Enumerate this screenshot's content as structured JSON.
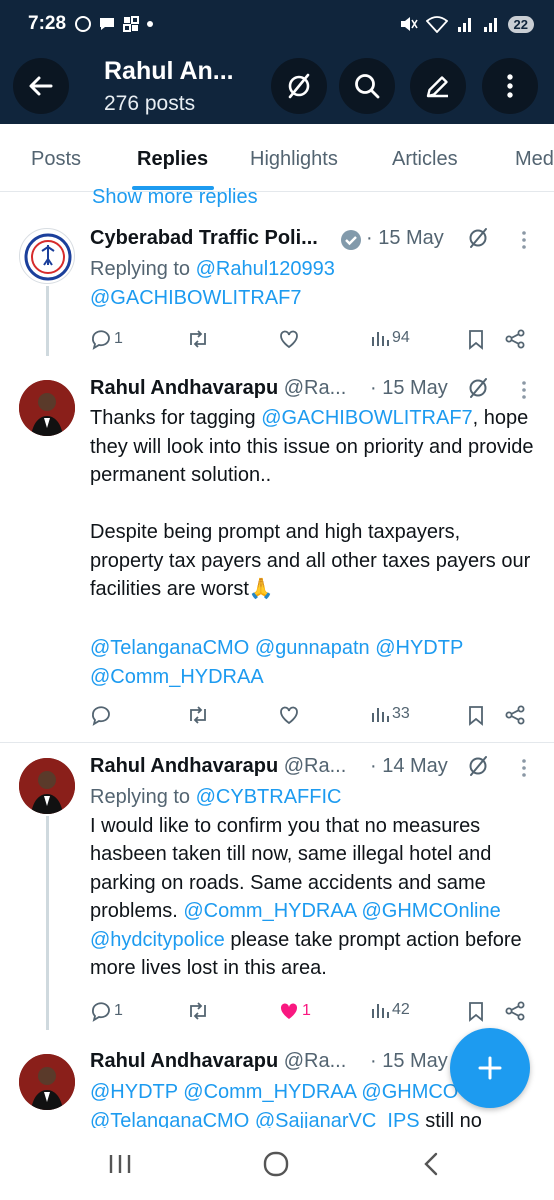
{
  "status_bar": {
    "time": "7:28",
    "battery": "22"
  },
  "header": {
    "title": "Rahul An...",
    "subtitle": "276 posts"
  },
  "tabs": [
    {
      "label": "Posts"
    },
    {
      "label": "Replies"
    },
    {
      "label": "Highlights"
    },
    {
      "label": "Articles"
    },
    {
      "label": "Media"
    }
  ],
  "feed": {
    "show_more": "Show more replies",
    "tweets": [
      {
        "name": "Cyberabad Traffic Poli...",
        "handle": "",
        "date": "· 15 May",
        "verified": true,
        "replying_label": "Replying to ",
        "replying_handles": "@Rahul120993",
        "body_line1": "@GACHIBOWLITRAF7",
        "replies": "1",
        "retweets": "",
        "likes": "",
        "views": "94"
      },
      {
        "name": "Rahul Andhavarapu",
        "handle": "@Ra...",
        "date": "· 15 May",
        "text_pre": "Thanks for tagging ",
        "text_mention": "@GACHIBOWLITRAF7",
        "text_post": ", hope they will look into this issue on priority and provide permanent solution..",
        "para2": "Despite being prompt and high taxpayers, property tax payers and all other taxes payers our facilities are worst🙏",
        "mentions1": "@TelanganaCMO @gunnapatn @HYDTP",
        "mentions2": "@Comm_HYDRAA",
        "replies": "",
        "views": "33"
      },
      {
        "name": "Rahul Andhavarapu",
        "handle": "@Ra...",
        "date": "· 14 May",
        "replying_label": "Replying to ",
        "replying_handles": "@CYBTRAFFIC",
        "text_a": "I would like to confirm you that no measures hasbeen taken till now, same illegal hotel and parking on roads. Same accidents and same problems. ",
        "m1": "@Comm_HYDRAA",
        "m2": "@GHMCOnline",
        "m3": "@hydcitypolice",
        "text_b": " please take prompt action before more lives lost in this area.",
        "replies": "1",
        "likes": "1",
        "views": "42"
      },
      {
        "name": "Rahul Andhavarapu",
        "handle": "@Ra...",
        "date": "· 15 May",
        "line1": "@HYDTP @Comm_HYDRAA @GHMCO",
        "line2_mentions": "@TelanganaCMO @SajjanarVC_IPS",
        "line2_text": " still no"
      }
    ]
  },
  "colors": {
    "header_bg": "#10253c",
    "accent": "#1d9bf0",
    "like": "#f91880",
    "muted": "#536471"
  },
  "icons": [
    "back-arrow-icon",
    "grok-icon",
    "search-icon",
    "edit-icon",
    "more-vertical-icon",
    "verified-badge-icon",
    "reply-icon",
    "retweet-icon",
    "like-icon",
    "views-icon",
    "bookmark-icon",
    "share-icon",
    "compose-plus-icon",
    "recents-icon",
    "home-icon",
    "back-nav-icon"
  ]
}
